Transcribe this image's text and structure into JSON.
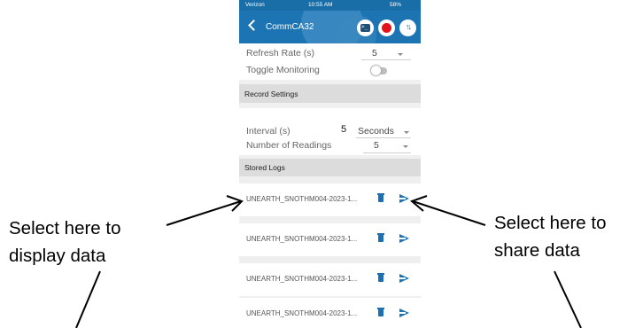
{
  "statusbar": {
    "carrier": "Verizon",
    "time": "10:55 AM",
    "battery": "58%"
  },
  "navbar": {
    "title": "CommCA32",
    "icons": [
      "chevron-left-icon",
      "terminal-icon",
      "record-icon",
      "sort-icon"
    ]
  },
  "settings": {
    "refresh_rate_label": "Refresh Rate (s)",
    "refresh_rate_value": "5",
    "toggle_monitoring_label": "Toggle Monitoring",
    "toggle_monitoring_on": false
  },
  "record_settings": {
    "header": "Record Settings",
    "interval_label": "Interval (s)",
    "interval_value": "5",
    "interval_unit": "Seconds",
    "readings_label": "Number of Readings",
    "readings_value": "5"
  },
  "stored_logs": {
    "header": "Stored Logs",
    "items": [
      {
        "name": "UNEARTH_SNOTHM004-2023-1..."
      },
      {
        "name": "UNEARTH_SNOTHM004-2023-1..."
      },
      {
        "name": "UNEARTH_SNOTHM004-2023-1..."
      },
      {
        "name": "UNEARTH_SNOTHM004-2023-1..."
      }
    ]
  },
  "annotations": {
    "left_line1": "Select here to",
    "left_line2": "display data",
    "right_line1": "Select here to",
    "right_line2": "share data"
  },
  "colors": {
    "accent": "#1d74b3",
    "record": "#e3141c",
    "section_bg": "#dcdcdc"
  }
}
